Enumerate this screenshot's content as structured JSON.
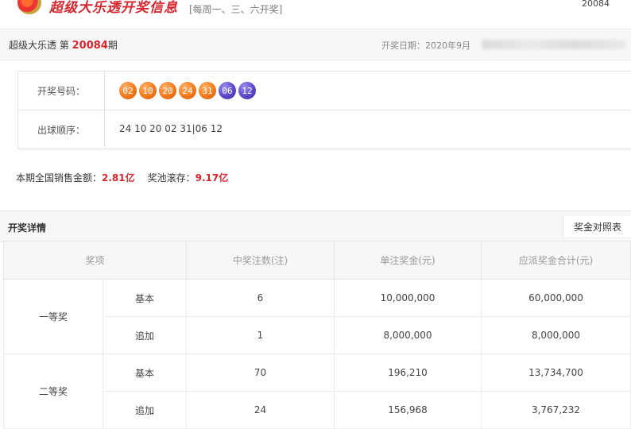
{
  "header": {
    "brand_title": "超级大乐透开奖信息",
    "schedule": "[每周一、三、六开奖]",
    "issue_corner": "20084"
  },
  "draw_bar": {
    "label_prefix": "超级大乐透 第 ",
    "issue": "20084",
    "label_suffix": "期",
    "date_text": "开奖日期：2020年9月"
  },
  "result": {
    "numbers_label": "开奖号码：",
    "red_balls": [
      "02",
      "10",
      "20",
      "24",
      "31"
    ],
    "blue_balls": [
      "06",
      "12"
    ],
    "order_label": "出球顺序：",
    "order_value": "24 10 20 02 31|06 12"
  },
  "sales": {
    "sales_label": "本期全国销售金额：",
    "sales_value": "2.81亿",
    "pool_label": "奖池滚存：",
    "pool_value": "9.17亿"
  },
  "details": {
    "title": "开奖详情",
    "compare_button": "奖金对照表",
    "columns": [
      "奖项",
      "中奖注数(注)",
      "单注奖金(元)",
      "应派奖金合计(元)"
    ],
    "groups": [
      {
        "prize": "一等奖",
        "rows": [
          {
            "type": "基本",
            "count": "6",
            "unit": "10,000,000",
            "total": "60,000,000"
          },
          {
            "type": "追加",
            "count": "1",
            "unit": "8,000,000",
            "total": "8,000,000"
          }
        ]
      },
      {
        "prize": "二等奖",
        "rows": [
          {
            "type": "基本",
            "count": "70",
            "unit": "196,210",
            "total": "13,734,700"
          },
          {
            "type": "追加",
            "count": "24",
            "unit": "156,968",
            "total": "3,767,232"
          }
        ]
      }
    ]
  },
  "colors": {
    "accent_red": "#d8262f",
    "red_ball": "#f47a1c",
    "blue_ball": "#5a49c9"
  }
}
